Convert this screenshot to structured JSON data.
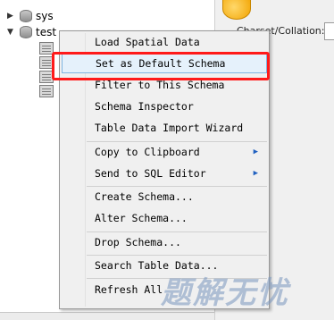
{
  "navigator": {
    "schemas": [
      {
        "name": "sys",
        "expanded": false
      },
      {
        "name": "test",
        "expanded": true
      }
    ]
  },
  "right_panel": {
    "charset_label": "Charset/Collation:"
  },
  "context_menu": {
    "items": [
      {
        "label": "Load Spatial Data",
        "selected": false,
        "submenu": false
      },
      {
        "label": "Set as Default Schema",
        "selected": true,
        "submenu": false
      },
      {
        "label": "Filter to This Schema",
        "selected": false,
        "submenu": false
      },
      {
        "label": "Schema Inspector",
        "selected": false,
        "submenu": false
      },
      {
        "label": "Table Data Import Wizard",
        "selected": false,
        "submenu": false
      },
      {
        "label": "Copy to Clipboard",
        "selected": false,
        "submenu": true
      },
      {
        "label": "Send to SQL Editor",
        "selected": false,
        "submenu": true
      },
      {
        "label": "Create Schema...",
        "selected": false,
        "submenu": false
      },
      {
        "label": "Alter Schema...",
        "selected": false,
        "submenu": false
      },
      {
        "label": "Drop Schema...",
        "selected": false,
        "submenu": false
      },
      {
        "label": "Search Table Data...",
        "selected": false,
        "submenu": false
      },
      {
        "label": "Refresh All",
        "selected": false,
        "submenu": false
      }
    ]
  },
  "watermark": "题解无忧",
  "colors": {
    "highlight_outline": "#ff1a1a",
    "selection_fill": "#e5f1fb",
    "submenu_arrow": "#2060c0"
  }
}
